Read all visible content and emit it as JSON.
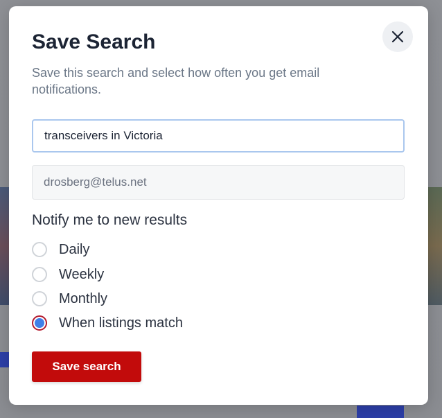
{
  "modal": {
    "title": "Save Search",
    "subtitle": "Save this search and select how often you get email notifications.",
    "close_icon": "close-icon",
    "search_field": {
      "value": "transceivers in Victoria"
    },
    "email_field": {
      "value": "drosberg@telus.net"
    },
    "notify_label": "Notify me to new results",
    "options": [
      {
        "label": "Daily",
        "checked": false
      },
      {
        "label": "Weekly",
        "checked": false
      },
      {
        "label": "Monthly",
        "checked": false
      },
      {
        "label": "When listings match",
        "checked": true
      }
    ],
    "save_label": "Save search"
  },
  "colors": {
    "primary_button": "#c20b0b",
    "radio_selected_ring": "#b31a2e",
    "radio_selected_dot": "#3f7fe8",
    "title_text": "#1c2434",
    "subtitle_text": "#6b7787"
  }
}
